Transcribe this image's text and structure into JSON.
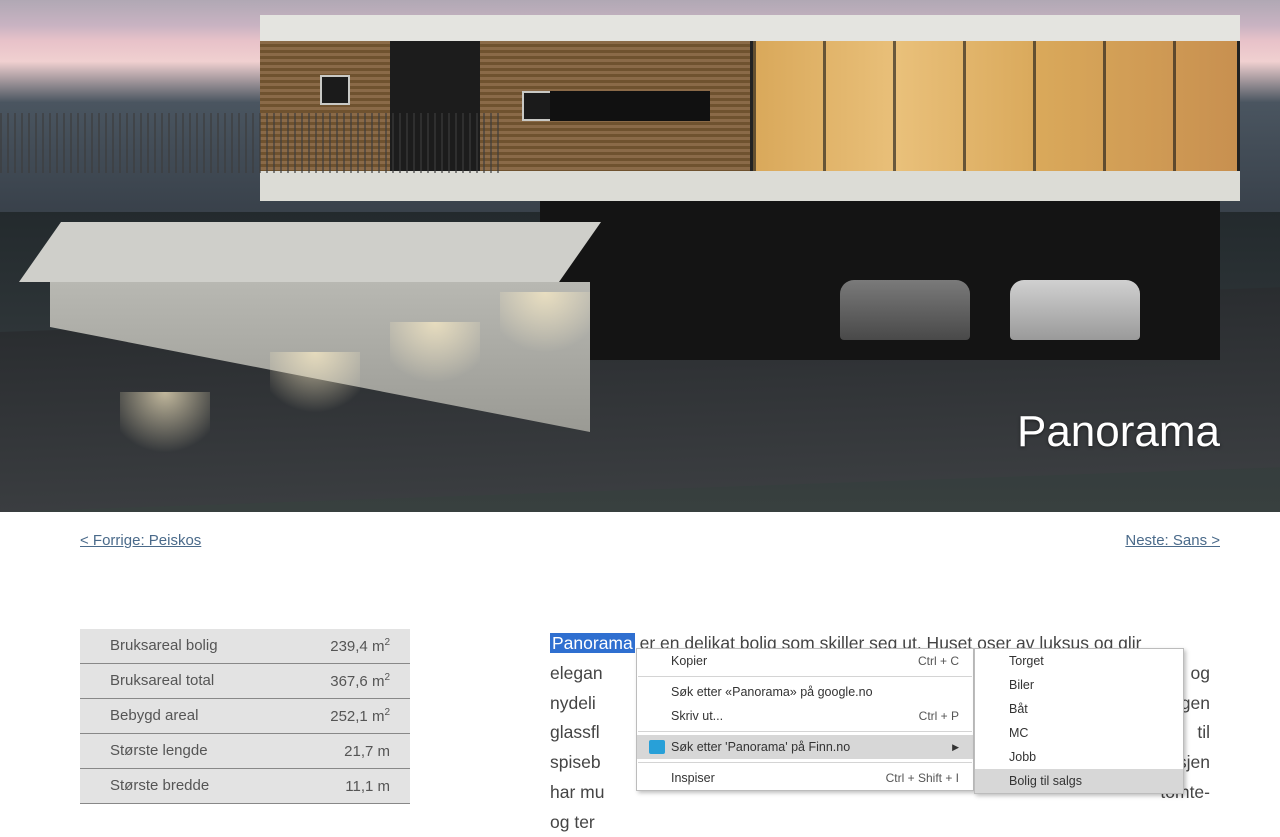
{
  "hero": {
    "title": "Panorama"
  },
  "nav": {
    "prev": "< Forrige: Peiskos",
    "next": "Neste: Sans >"
  },
  "specs": [
    {
      "label": "Bruksareal bolig",
      "value": "239,4 m",
      "sup": "2"
    },
    {
      "label": "Bruksareal total",
      "value": "367,6 m",
      "sup": "2"
    },
    {
      "label": "Bebygd areal",
      "value": "252,1 m",
      "sup": "2"
    },
    {
      "label": "Største lengde",
      "value": "21,7 m",
      "sup": ""
    },
    {
      "label": "Største bredde",
      "value": "11,1 m",
      "sup": ""
    }
  ],
  "description": {
    "highlight": "Panorama",
    "line1_rest": " er en delikat bolig som skiller seg ut. Huset oser av luksus og glir",
    "line2a": "elegan",
    "line2b": "og",
    "line3a": "nydeli",
    "line3b": "ningen",
    "line4a": "glassfl",
    "line4b": "til",
    "line5a": "spiseb",
    "line5b": "asjen",
    "line6a": "har mu",
    "line6b": "tomte-",
    "line7a": "og ter"
  },
  "context_menu": {
    "items": [
      {
        "label": "Kopier",
        "accel": "Ctrl + C",
        "sep_after": true
      },
      {
        "label": "Søk etter «Panorama» på google.no",
        "accel": ""
      },
      {
        "label": "Skriv ut...",
        "accel": "Ctrl + P",
        "sep_after": true
      },
      {
        "label": "Søk etter 'Panorama' på Finn.no",
        "accel": "",
        "icon": "finn",
        "submenu": true,
        "hover": true,
        "sep_after": true
      },
      {
        "label": "Inspiser",
        "accel": "Ctrl + Shift + I"
      }
    ],
    "submenu_items": [
      {
        "label": "Torget"
      },
      {
        "label": "Biler"
      },
      {
        "label": "Båt"
      },
      {
        "label": "MC"
      },
      {
        "label": "Jobb"
      },
      {
        "label": "Bolig til salgs",
        "hover": true
      }
    ]
  }
}
